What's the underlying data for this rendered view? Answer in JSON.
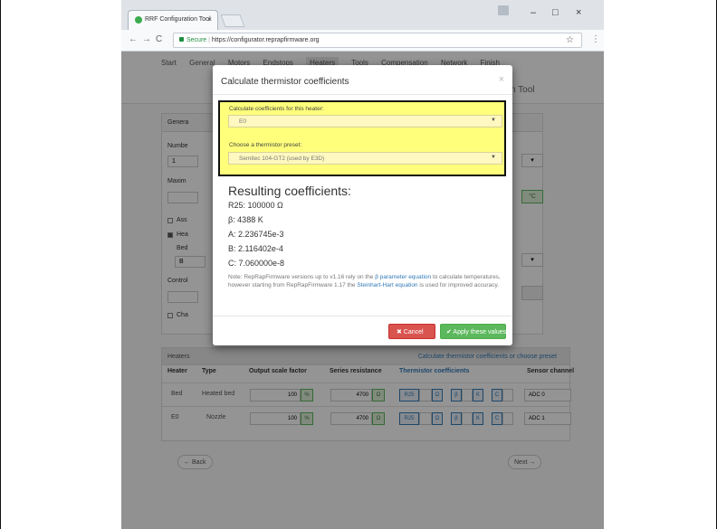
{
  "browser": {
    "tab_title": "RRF Configuration Tool",
    "secure_label": "Secure",
    "url": "https://configurator.reprapfirmware.org"
  },
  "page": {
    "nav_tabs": [
      "Start",
      "General",
      "Motors",
      "Endstops",
      "Heaters",
      "Tools",
      "Compensation",
      "Network",
      "Finish"
    ],
    "title_fragment": "n Tool",
    "general_panel": {
      "header_fragment": "Genera",
      "number_label_fragment": "Numbe",
      "number_value": "1",
      "maximum_label_fragment": "Maxim",
      "chk1_fragment": "Ass",
      "chk2_fragment": "Hea",
      "bed_label_fragment": "Bed",
      "bed_value_fragment": "B",
      "control_label_fragment": "Control",
      "chk3_fragment": "Cha",
      "unit_c": "°C"
    },
    "heaters_panel": {
      "title": "Heaters",
      "link": "Calculate thermistor coefficients or choose preset",
      "columns": [
        "Heater",
        "Type",
        "Output scale factor",
        "Series resistance",
        "Thermistor coefficients",
        "Sensor channel"
      ],
      "rows": [
        {
          "heater": "Bed",
          "type": "Heated bed",
          "scale": "100",
          "scale_unit": "%",
          "series": "4700",
          "series_unit": "Ω",
          "r25": "R25",
          "r25_unit": "Ω",
          "beta": "β",
          "beta_unit": "K",
          "c": "C",
          "channel": "ADC 0"
        },
        {
          "heater": "E0",
          "type": "Nozzle",
          "scale": "100",
          "scale_unit": "%",
          "series": "4700",
          "series_unit": "Ω",
          "r25": "R25",
          "r25_unit": "Ω",
          "beta": "β",
          "beta_unit": "K",
          "c": "C",
          "channel": "ADC 1"
        }
      ]
    },
    "back_label": "← Back",
    "next_label": "Next →"
  },
  "modal": {
    "title": "Calculate thermistor coefficients",
    "close": "×",
    "heater_label": "Calculate coefficients for this heater:",
    "heater_value": "E0",
    "preset_label": "Choose a thermistor preset:",
    "preset_value": "Semitec 104-GT2 (used by E3D)",
    "results_title": "Resulting coefficients:",
    "r25": "R25: 100000 Ω",
    "beta": "β: 4388 K",
    "a": "A: 2.236745e-3",
    "b": "B: 2.116402e-4",
    "c": "C: 7.060000e-8",
    "note_start": "Note: RepRapFirmware versions up to v1.16 rely on the ",
    "note_link1": "β parameter equation",
    "note_mid": " to calculate temperatures, however starting from RepRapFirmware 1.17 the ",
    "note_link2": "Steinhart-Hart equation",
    "note_end": " is used for improved accuracy.",
    "cancel_label": "✖ Cancel",
    "apply_label": "✔ Apply these values"
  }
}
